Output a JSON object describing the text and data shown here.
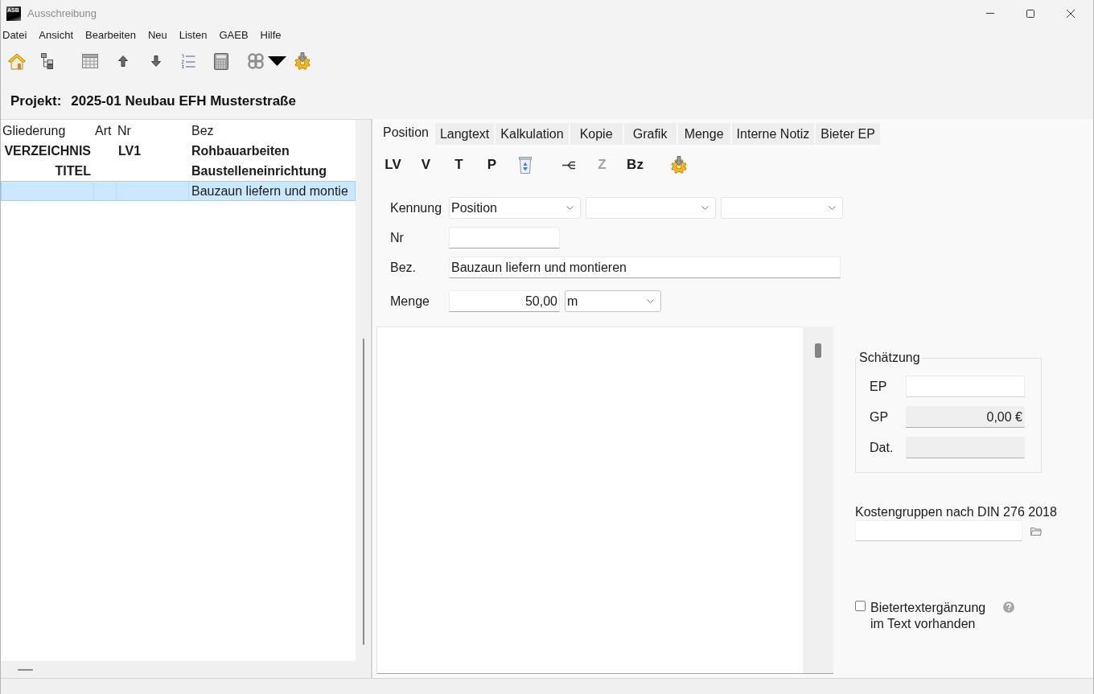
{
  "window": {
    "title": "Ausschreibung",
    "logo": "ASB"
  },
  "menu": [
    "Datei",
    "Ansicht",
    "Bearbeiten",
    "Neu",
    "Listen",
    "GAEB",
    "Hilfe"
  ],
  "project": {
    "label": "Projekt:",
    "name": "2025-01 Neubau EFH Musterstraße"
  },
  "tree": {
    "columns": [
      "Gliederung",
      "Art",
      "Nr",
      "Bez"
    ],
    "rows": [
      {
        "kind": "group",
        "outline": "VERZEICHNIS",
        "number": "LV1",
        "description": "Rohbauarbeiten",
        "selected": false
      },
      {
        "kind": "group",
        "outline": "TITEL",
        "description": "Baustelleneinrichtung",
        "selected": false
      },
      {
        "kind": "item",
        "description": "Bauzaun liefern und montie",
        "selected": true
      }
    ]
  },
  "tabs": [
    {
      "label": "Position",
      "selected": true
    },
    {
      "label": "Langtext",
      "selected": false
    },
    {
      "label": "Kalkulation",
      "selected": false
    },
    {
      "label": "Kopie",
      "selected": false
    },
    {
      "label": "Grafik",
      "selected": false
    },
    {
      "label": "Menge",
      "selected": false
    },
    {
      "label": "Interne Notiz",
      "selected": false
    },
    {
      "label": "Bieter EP",
      "selected": false
    }
  ],
  "tools": [
    {
      "label": "LV",
      "disabled": false
    },
    {
      "label": "V",
      "disabled": false
    },
    {
      "label": "T",
      "disabled": false
    },
    {
      "label": "P",
      "disabled": false
    },
    {
      "label": "Z",
      "disabled": true
    },
    {
      "label": "Bz",
      "disabled": false
    }
  ],
  "form": {
    "kennung": {
      "label": "Kennung",
      "value": "Position"
    },
    "nr": {
      "label": "Nr"
    },
    "bez": {
      "label": "Bez.",
      "value": "Bauzaun liefern und montieren"
    },
    "menge": {
      "label": "Menge",
      "value": "50,00",
      "unit": "m"
    }
  },
  "estimate": {
    "title": "Schätzung",
    "fields": [
      {
        "label": "EP",
        "disabled": false
      },
      {
        "label": "GP",
        "value": "0,00 €",
        "disabled": true
      },
      {
        "label": "Dat.",
        "disabled": true
      }
    ]
  },
  "cost_group": {
    "label": "Kostengruppen nach DIN 276 2018"
  },
  "bidder_text": {
    "label": "Bietertextergänzung im Text vorhanden",
    "checked": false
  }
}
